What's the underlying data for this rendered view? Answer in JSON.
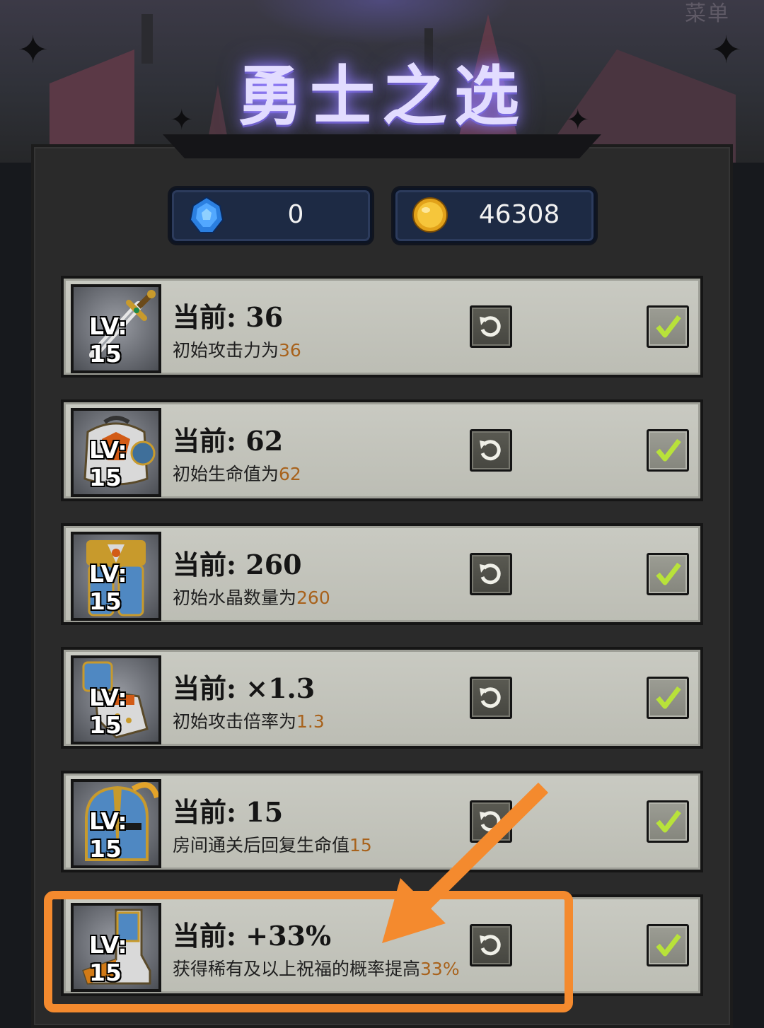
{
  "header": {
    "title": "勇士之选",
    "menu_label": "菜单"
  },
  "currency": {
    "gems": {
      "icon": "blue-crystal-icon",
      "value": "0"
    },
    "gold": {
      "icon": "gold-coin-icon",
      "value": "46308"
    }
  },
  "upgrades": [
    {
      "item": "sword",
      "level_label": "LV: 15",
      "current": "当前: 36",
      "desc_prefix": "初始攻击力为",
      "desc_value": "36"
    },
    {
      "item": "chest-armor",
      "level_label": "LV: 15",
      "current": "当前: 62",
      "desc_prefix": "初始生命值为",
      "desc_value": "62"
    },
    {
      "item": "leg-armor",
      "level_label": "LV: 15",
      "current": "当前: 260",
      "desc_prefix": "初始水晶数量为",
      "desc_value": "260"
    },
    {
      "item": "gauntlet",
      "level_label": "LV: 15",
      "current": "当前: ×1.3",
      "desc_prefix": "初始攻击倍率为",
      "desc_value": "1.3"
    },
    {
      "item": "helmet",
      "level_label": "LV: 15",
      "current": "当前: 15",
      "desc_prefix": "房间通关后回复生命值",
      "desc_value": "15"
    },
    {
      "item": "boots",
      "level_label": "LV: 15",
      "current": "当前: +33%",
      "desc_prefix": "获得稀有及以上祝福的概率提高",
      "desc_value": "33%"
    }
  ],
  "buttons": {
    "refresh_icon": "refresh-icon",
    "confirm_icon": "checkmark-icon"
  },
  "colors": {
    "highlight_value": "#a8621c",
    "annotation": "#f48a2e",
    "title_glow": "#9a86ff"
  }
}
